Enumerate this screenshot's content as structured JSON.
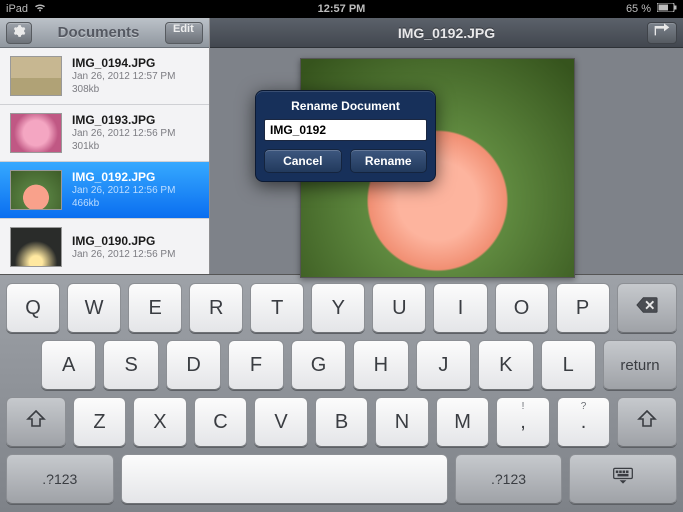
{
  "status_bar": {
    "carrier": "iPad",
    "time": "12:57 PM",
    "battery": "65 %"
  },
  "sidebar": {
    "title": "Documents",
    "edit_label": "Edit",
    "items": [
      {
        "name": "IMG_0194.JPG",
        "date": "Jan 26, 2012 12:57 PM",
        "size": "308kb",
        "selected": false
      },
      {
        "name": "IMG_0193.JPG",
        "date": "Jan 26, 2012 12:56 PM",
        "size": "301kb",
        "selected": false
      },
      {
        "name": "IMG_0192.JPG",
        "date": "Jan 26, 2012 12:56 PM",
        "size": "466kb",
        "selected": true
      },
      {
        "name": "IMG_0190.JPG",
        "date": "Jan 26, 2012 12:56 PM",
        "size": "",
        "selected": false
      }
    ]
  },
  "viewer": {
    "title": "IMG_0192.JPG"
  },
  "modal": {
    "title": "Rename Document",
    "input_value": "IMG_0192",
    "cancel_label": "Cancel",
    "confirm_label": "Rename"
  },
  "keyboard": {
    "row1": [
      "Q",
      "W",
      "E",
      "R",
      "T",
      "Y",
      "U",
      "I",
      "O",
      "P"
    ],
    "row2": [
      "A",
      "S",
      "D",
      "F",
      "G",
      "H",
      "J",
      "K",
      "L"
    ],
    "row3": [
      "Z",
      "X",
      "C",
      "V",
      "B",
      "N",
      "M"
    ],
    "row3_punct": [
      {
        "main": ",",
        "sub": "!"
      },
      {
        "main": ".",
        "sub": "?"
      }
    ],
    "return_label": "return",
    "sym_label": ".?123"
  }
}
